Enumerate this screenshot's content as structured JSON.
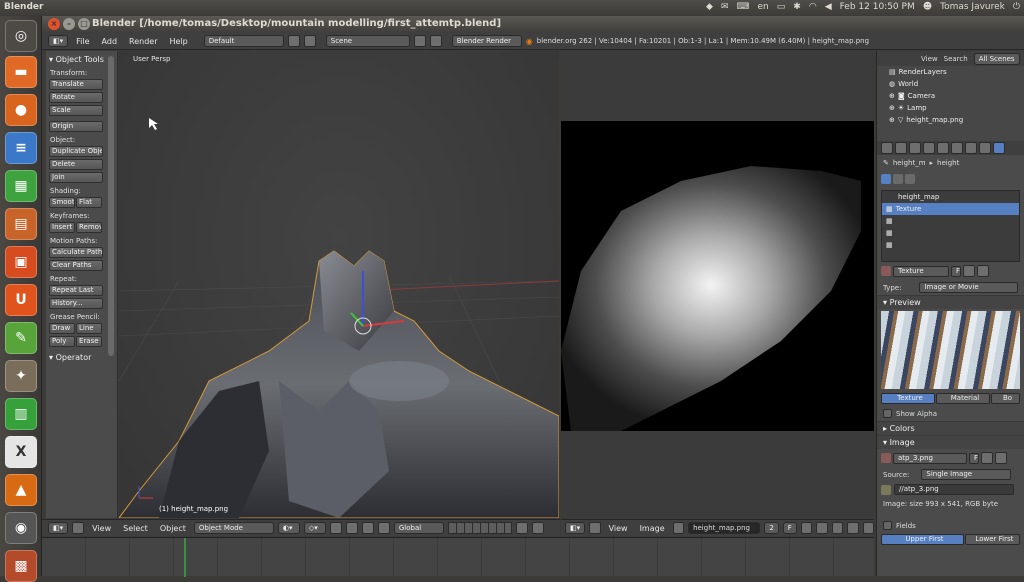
{
  "topbar": {
    "app": "Blender",
    "tray_lang": "en",
    "datetime": "Feb 12 10:50 PM",
    "user": "Tomas Javurek"
  },
  "window": {
    "title": "Blender [/home/tomas/Desktop/mountain modelling/first_attemtp.blend]"
  },
  "infobar": {
    "menus": [
      "File",
      "Add",
      "Render",
      "Help"
    ],
    "layout": "Default",
    "scene": "Scene",
    "engine": "Blender Render",
    "stats": "blender.org 262 | Ve:10404 | Fa:10201 | Ob:1-3 | La:1 | Mem:10.49M (6.40M) | height_map.png"
  },
  "toolshelf": {
    "title": "Object Tools",
    "transform_label": "Transform:",
    "translate": "Translate",
    "rotate": "Rotate",
    "scale": "Scale",
    "origin": "Origin",
    "object_label": "Object:",
    "duplicate": "Duplicate Objec",
    "delete": "Delete",
    "join": "Join",
    "shading_label": "Shading:",
    "smooth": "Smooth",
    "flat": "Flat",
    "keyframes_label": "Keyframes:",
    "insert": "Insert",
    "remove": "Remov",
    "motion_label": "Motion Paths:",
    "calc_paths": "Calculate Paths",
    "clear_paths": "Clear Paths",
    "repeat_label": "Repeat:",
    "repeat_last": "Repeat Last",
    "history": "History...",
    "grease_label": "Grease Pencil:",
    "draw": "Draw",
    "line": "Line",
    "poly": "Poly",
    "erase": "Erase",
    "operator": "Operator"
  },
  "view3d": {
    "persp": "User Persp",
    "object_label": "(1) height_map.png"
  },
  "v3header": {
    "view": "View",
    "select": "Select",
    "object": "Object",
    "mode": "Object Mode",
    "orientation": "Global"
  },
  "imgheader": {
    "view": "View",
    "image": "Image",
    "image_name": "height_map.png",
    "users": "2",
    "fake": "F"
  },
  "outliner": {
    "view": "View",
    "search": "Search",
    "filter": "All Scenes",
    "items": [
      "RenderLayers",
      "World",
      "Camera",
      "Lamp",
      "height_map.png"
    ]
  },
  "props": {
    "breadcrumb_obj": "height_m",
    "breadcrumb_tex": "height",
    "slots": [
      "height_map",
      "Texture"
    ],
    "tex_name": "Texture",
    "tex_fake": "F",
    "type_label": "Type:",
    "type_value": "Image or Movie",
    "preview": "Preview",
    "tabs": [
      "Texture",
      "Material",
      "Bo"
    ],
    "show_alpha": "Show Alpha",
    "colors": "Colors",
    "image": "Image",
    "image_name": "atp_3.png",
    "image_fake": "F",
    "source_label": "Source:",
    "source_value": "Single Image",
    "filepath": "//atp_3.png",
    "info": "Image: size 993 x 541, RGB byte",
    "fields": "Fields",
    "field_first": "Upper First",
    "field_lower": "Lower First"
  },
  "colors": {
    "accent": "#5680c2",
    "bg": "#3c3b37"
  }
}
